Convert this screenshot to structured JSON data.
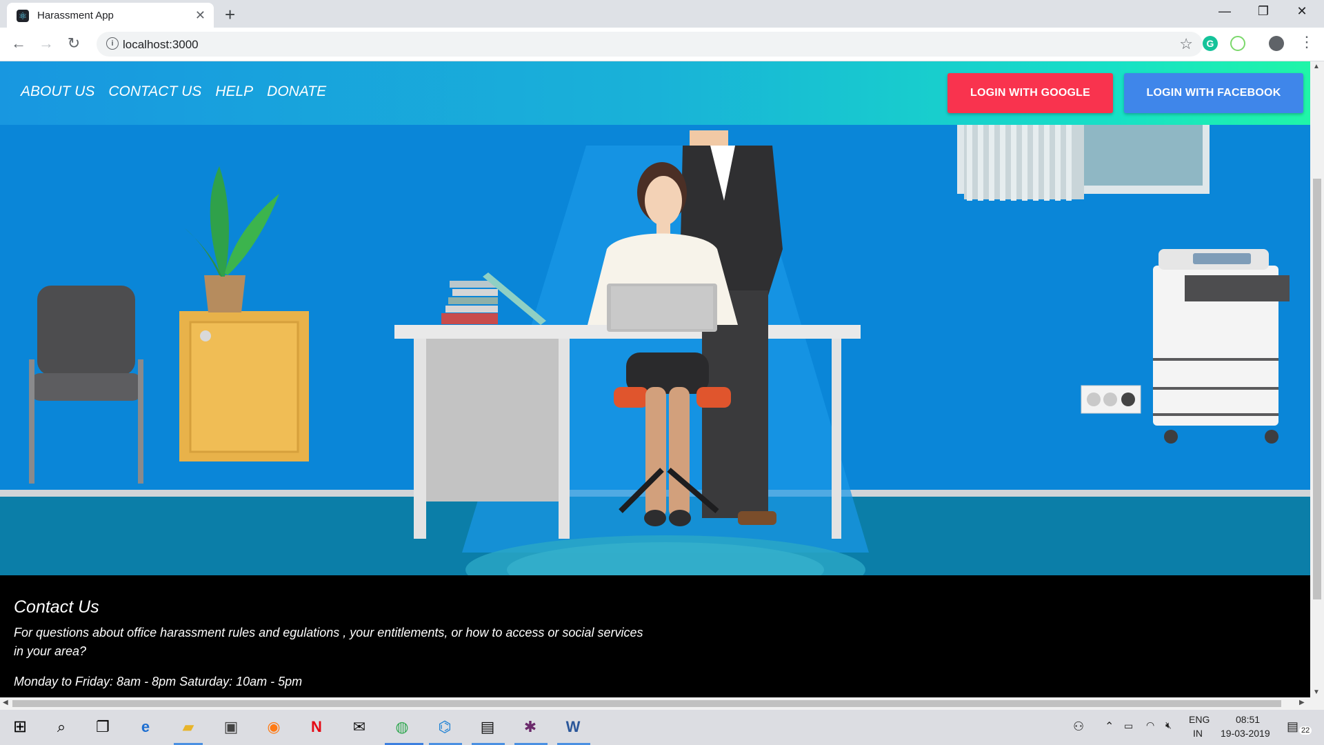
{
  "browser": {
    "tab_title": "Harassment App",
    "url": "localhost:3000"
  },
  "nav": {
    "links": [
      "ABOUT US",
      "CONTACT US",
      "HELP",
      "DONATE"
    ],
    "login_google": "LOGIN WITH GOOGLE",
    "login_facebook": "LOGIN WITH FACEBOOK"
  },
  "footer": {
    "title": "Contact Us",
    "description": "For questions about office harassment rules and egulations , your entitlements, or how to access or social services in your area?",
    "hours": "Monday to Friday: 8am - 8pm Saturday: 10am - 5pm"
  },
  "taskbar": {
    "lang_top": "ENG",
    "lang_bottom": "IN",
    "time": "08:51",
    "date": "19-03-2019",
    "notifications": "22"
  },
  "colors": {
    "google_button": "#f9334e",
    "facebook_button": "#3f86ea",
    "hero_wall": "#0a86d8",
    "hero_floor": "#0b7ea8"
  }
}
